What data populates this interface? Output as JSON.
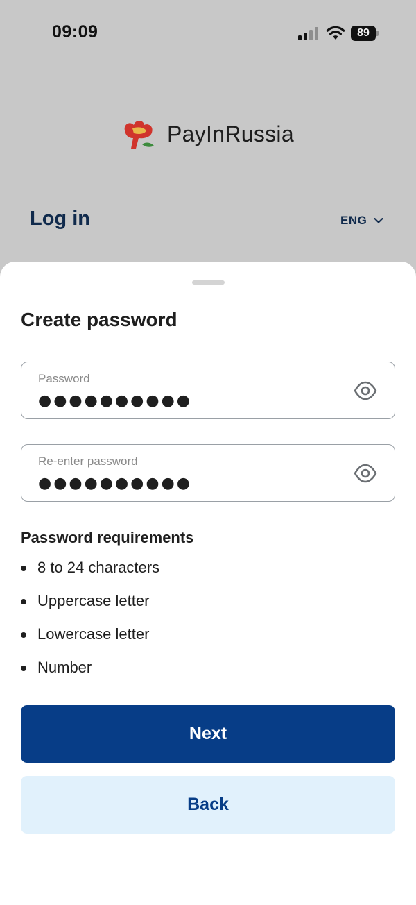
{
  "status_bar": {
    "time": "09:09",
    "battery": "89"
  },
  "brand": {
    "name": "PayInRussia",
    "colors": {
      "red": "#d0342c",
      "gold": "#e9b84a",
      "green": "#3d8b3d"
    }
  },
  "header": {
    "title": "Log in",
    "language": "ENG"
  },
  "sheet": {
    "title": "Create password",
    "password_field": {
      "label": "Password",
      "value": "●●●●●●●●●●"
    },
    "reenter_field": {
      "label": "Re-enter password",
      "value": "●●●●●●●●●●"
    },
    "requirements": {
      "title": "Password requirements",
      "items": [
        "8 to 24 characters",
        "Uppercase letter",
        "Lowercase letter",
        "Number"
      ]
    },
    "buttons": {
      "next": "Next",
      "back": "Back"
    }
  },
  "colors": {
    "primary": "#073d87",
    "secondary_bg": "#e1f1fc",
    "header_text": "#102a4c",
    "overlay": "#c8c8c8"
  }
}
